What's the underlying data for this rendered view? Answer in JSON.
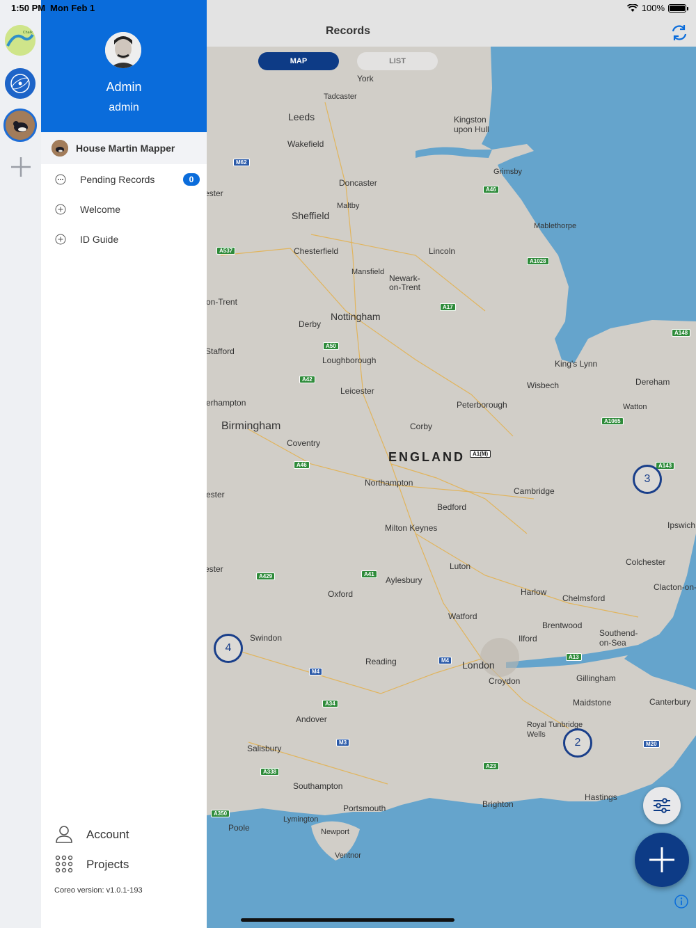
{
  "status": {
    "time": "1:50 PM",
    "date": "Mon Feb 1",
    "battery": "100%"
  },
  "rail": {
    "items": [
      "Chalk Valley Farmer Cluster",
      "project-globe",
      "House Martin Mapper"
    ]
  },
  "drawer": {
    "name": "Admin",
    "username": "admin",
    "project": "House Martin Mapper",
    "menu": [
      {
        "label": "Pending Records",
        "badge": "0"
      },
      {
        "label": "Welcome"
      },
      {
        "label": "ID Guide"
      }
    ],
    "account": "Account",
    "projects": "Projects",
    "version": "Coreo version: v1.0.1-193"
  },
  "header": {
    "title": "Records"
  },
  "segmented": {
    "map": "MAP",
    "list": "LIST"
  },
  "map": {
    "country": "ENGLAND",
    "places": [
      "York",
      "Tadcaster",
      "Leeds",
      "Wakefield",
      "Kingston upon Hull",
      "Grimsby",
      "Doncaster",
      "Maltby",
      "Sheffield",
      "Mablethorpe",
      "Chesterfield",
      "Lincoln",
      "Mansfield",
      "Newark-on-Trent",
      "Nottingham",
      "Derby",
      "Loughborough",
      "Stafford",
      "King's Lynn",
      "Dereham",
      "Wisbech",
      "Leicester",
      "Peterborough",
      "Watton",
      "Birmingham",
      "Corby",
      "Coventry",
      "Northampton",
      "Cambridge",
      "Bedford",
      "Milton Keynes",
      "Luton",
      "Aylesbury",
      "Oxford",
      "Harlow",
      "Colchester",
      "Chelmsford",
      "Watford",
      "Brentwood",
      "Swindon",
      "Ilford",
      "Reading",
      "London",
      "Southend-on-Sea",
      "Croydon",
      "Gillingham",
      "Maidstone",
      "Canterbury",
      "Andover",
      "Royal Tunbridge Wells",
      "Salisbury",
      "Southampton",
      "Portsmouth",
      "Brighton",
      "Hastings",
      "Lymington",
      "Poole",
      "Newport",
      "Ventnor",
      "Ipswich",
      "Clacton-on-Sea",
      "ester",
      "on-Trent",
      "erhampton",
      "ester",
      "ester"
    ],
    "clusters": [
      "3",
      "4",
      "2"
    ],
    "roads": [
      "M62",
      "A46",
      "A537",
      "A1028",
      "A17",
      "A50",
      "A42",
      "A148",
      "A1065",
      "A143",
      "A1(M)",
      "A46",
      "A429",
      "A41",
      "M4",
      "A13",
      "M4",
      "A34",
      "M3",
      "A338",
      "A23",
      "M20",
      "A350"
    ]
  },
  "colors": {
    "primary": "#0a6cdb",
    "navy": "#0d3b86",
    "sea": "#65a4cc",
    "land": "#d1cec8"
  }
}
